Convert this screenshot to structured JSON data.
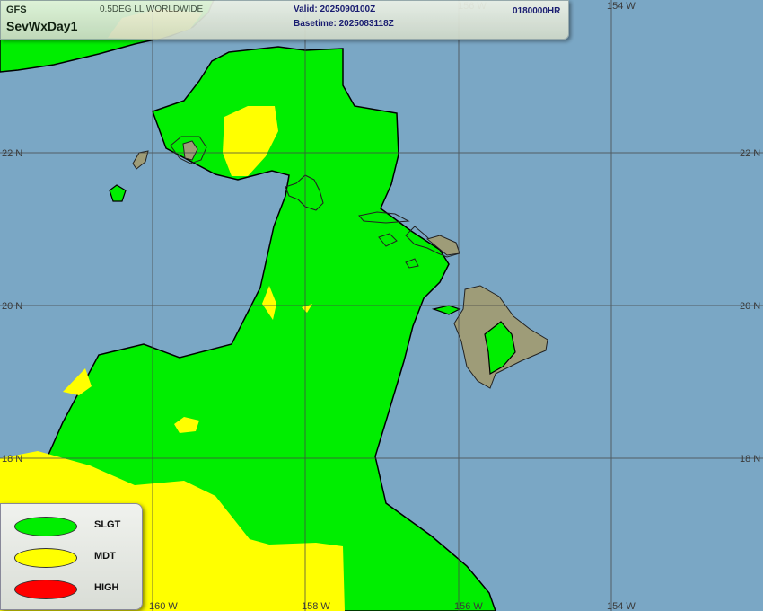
{
  "header": {
    "model": "GFS",
    "product": "SevWxDay1",
    "grid": "0.5DEG LL WORLDWIDE",
    "valid": "Valid: 2025090100Z",
    "basetime": "Basetime: 2025083118Z",
    "forecast_hour": "0180000HR"
  },
  "grid_labels": {
    "lat_22": "22 N",
    "lat_20": "20 N",
    "lat_18": "18 N",
    "lon_160": "160 W",
    "lon_158": "158 W",
    "lon_156": "156 W",
    "lon_154": "154 W"
  },
  "legend": [
    {
      "label": "SLGT",
      "color": "#00ee00"
    },
    {
      "label": "MDT",
      "color": "#ffff00"
    },
    {
      "label": "HIGH",
      "color": "#ff0000"
    }
  ],
  "colors": {
    "ocean": "#7aa7c5",
    "slgt": "#00ee00",
    "mdt": "#ffff00",
    "land": "#9e9c78"
  }
}
